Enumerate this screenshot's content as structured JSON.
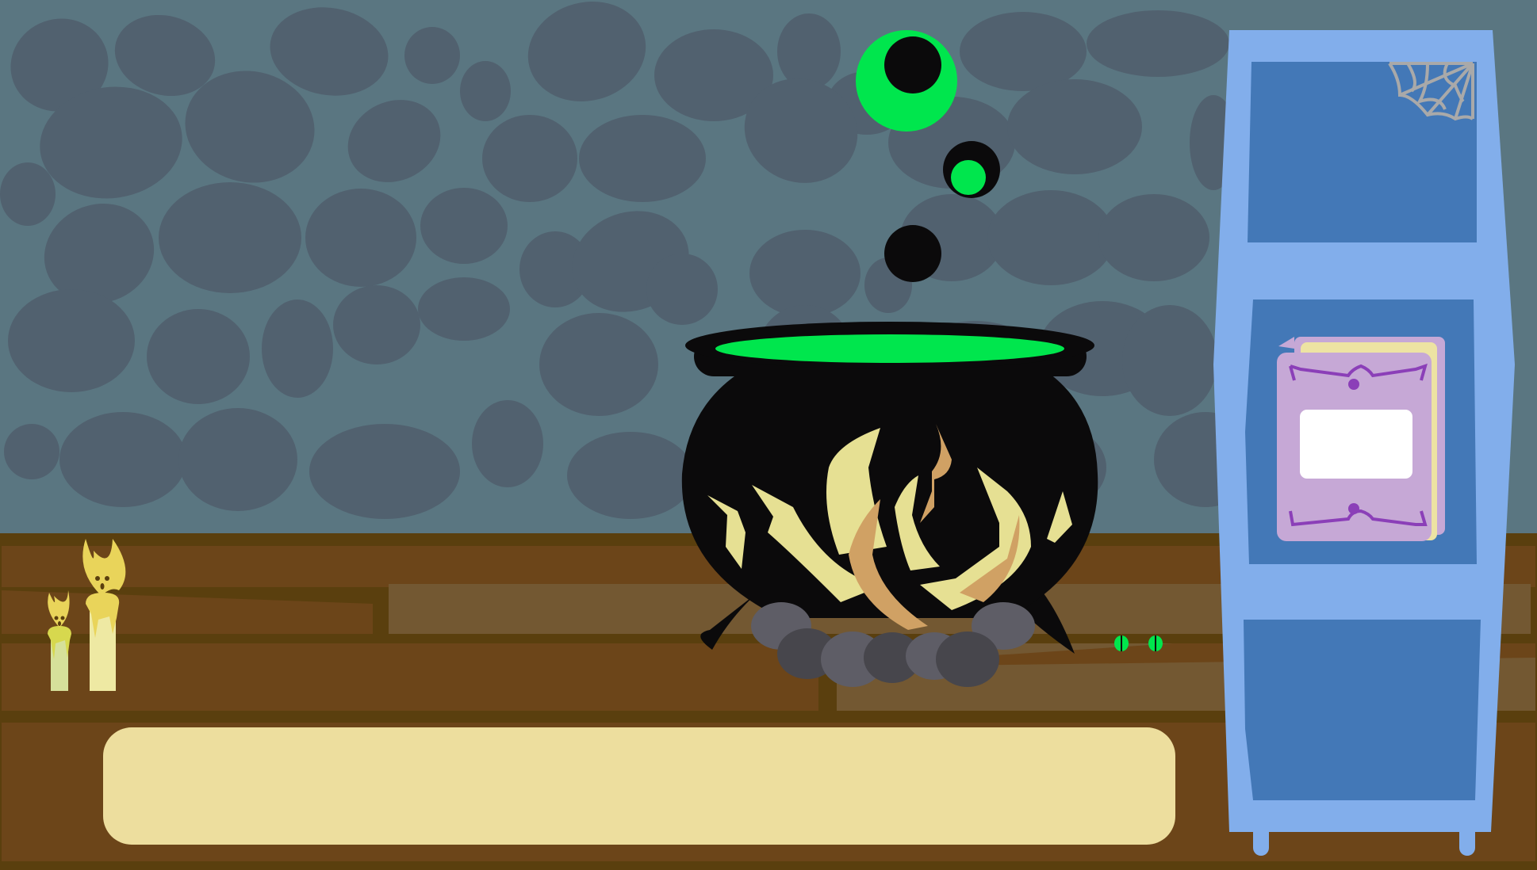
{
  "scene": {
    "name": "witch-cauldron-room",
    "colors": {
      "wall": "#5a7681",
      "stones": "#51616f",
      "wood_floor": "#6c4519",
      "wood_dark": "#5a3f0e",
      "wood_light": "#735832",
      "cauldron": "#0b0a0b",
      "potion": "#00e64d",
      "flame_pale": "#e6e093",
      "flame_orange": "#d0a164",
      "rock": "#5e5d66",
      "rock_dark": "#47464c",
      "shelf_frame": "#82aeeb",
      "shelf_inner": "#4378b7",
      "book_cover": "#c6a8d6",
      "book_pages": "#ede3a3",
      "book_trim": "#8b3fb8",
      "dialog": "#edde9e",
      "candle_wax": "#eee9a3",
      "candle_flame": "#e9d45a",
      "eyes": "#00e64d"
    }
  },
  "dialog": {
    "text": ""
  },
  "spellbook": {
    "label": ""
  },
  "icons": [
    "cauldron-icon",
    "bubble-icon",
    "candle-icon",
    "spellbook-icon",
    "cobweb-icon",
    "glowing-eyes-icon",
    "campfire-icon"
  ]
}
